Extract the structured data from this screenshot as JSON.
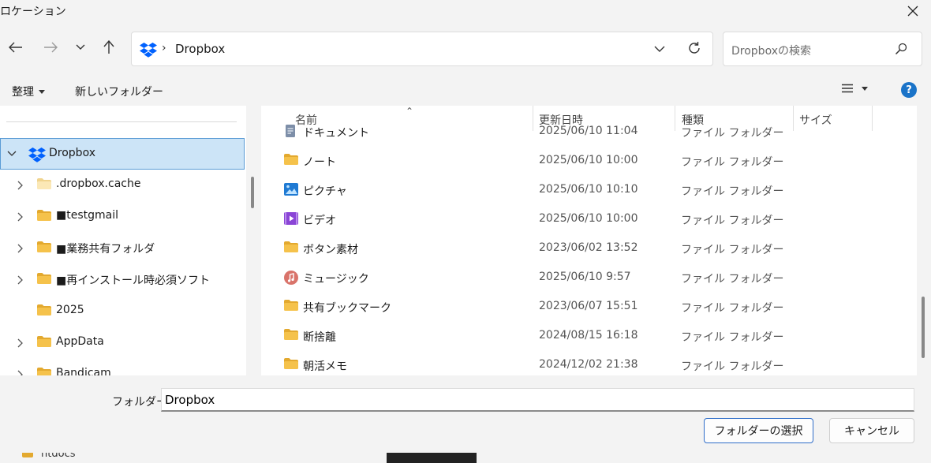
{
  "window": {
    "title": "ロケーション"
  },
  "address": {
    "current": "Dropbox"
  },
  "search": {
    "placeholder": "Dropboxの検索"
  },
  "commands": {
    "organize": "整理",
    "new_folder": "新しいフォルダー",
    "help": "?"
  },
  "nav": {
    "items": [
      {
        "label": "Dropbox",
        "expanded": true,
        "selected": true,
        "icon": "dropbox-icon"
      },
      {
        "label": ".dropbox.cache",
        "icon": "folder-icon-pale"
      },
      {
        "label": "■testgmail",
        "icon": "folder-icon"
      },
      {
        "label": "■業務共有フォルダ",
        "icon": "folder-icon"
      },
      {
        "label": "■再インストール時必須ソフト",
        "icon": "folder-icon"
      },
      {
        "label": "2025",
        "icon": "folder-icon",
        "no_chevron": true
      },
      {
        "label": "AppData",
        "icon": "folder-icon"
      },
      {
        "label": "Bandicam",
        "icon": "folder-icon"
      }
    ]
  },
  "columns": {
    "name": "名前",
    "date": "更新日時",
    "type": "種類",
    "size": "サイズ"
  },
  "files": [
    {
      "name": "ドキュメント",
      "date": "2025/06/10 11:04",
      "type": "ファイル フォルダー",
      "icon": "documents-icon"
    },
    {
      "name": "ノート",
      "date": "2025/06/10 10:00",
      "type": "ファイル フォルダー",
      "icon": "folder-icon"
    },
    {
      "name": "ピクチャ",
      "date": "2025/06/10 10:10",
      "type": "ファイル フォルダー",
      "icon": "pictures-icon"
    },
    {
      "name": "ビデオ",
      "date": "2025/06/10 10:00",
      "type": "ファイル フォルダー",
      "icon": "videos-icon"
    },
    {
      "name": "ボタン素材",
      "date": "2023/06/02 13:52",
      "type": "ファイル フォルダー",
      "icon": "folder-icon"
    },
    {
      "name": "ミュージック",
      "date": "2025/06/10 9:57",
      "type": "ファイル フォルダー",
      "icon": "music-icon"
    },
    {
      "name": "共有ブックマーク",
      "date": "2023/06/07 15:51",
      "type": "ファイル フォルダー",
      "icon": "folder-icon"
    },
    {
      "name": "断捨離",
      "date": "2024/08/15 16:18",
      "type": "ファイル フォルダー",
      "icon": "folder-icon"
    },
    {
      "name": "朝活メモ",
      "date": "2024/12/02 21:38",
      "type": "ファイル フォルダー",
      "icon": "folder-icon"
    }
  ],
  "footer": {
    "folder_label": "フォルダー:",
    "folder_value": "Dropbox",
    "select_button": "フォルダーの選択",
    "cancel_button": "キャンセル"
  },
  "behind": {
    "left_text": "htdocs"
  },
  "colors": {
    "folder": "#f5c24b",
    "folder_dark": "#e3a92f",
    "accent": "#1a73c8",
    "selection": "#cce4f7",
    "dropbox": "#0061fe"
  }
}
